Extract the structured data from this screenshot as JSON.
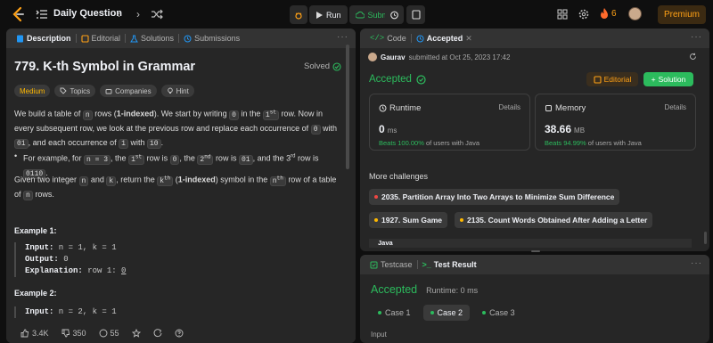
{
  "topbar": {
    "list_label": "Daily Question",
    "run_label": "Run",
    "submit_label": "Submit",
    "streak_count": "6",
    "premium_label": "Premium"
  },
  "left_tabs": [
    "Description",
    "Editorial",
    "Solutions",
    "Submissions"
  ],
  "problem": {
    "title": "779. K-th Symbol in Grammar",
    "status": "Solved",
    "chips": [
      "Medium",
      "Topics",
      "Companies",
      "Hint"
    ],
    "p1": {
      "t1": "We build a table of ",
      "c1": "n",
      "t2": " rows (",
      "b1": "1-indexed",
      "t3": "). We start by writing ",
      "c2": "0",
      "t4": " in the ",
      "s1": "1",
      "sup1": "st",
      "t5": " row. Now in every subsequent row, we look at the previous row and replace each occurrence of ",
      "c3": "0",
      "t6": " with ",
      "c4": "01",
      "t7": ", and each occurrence of ",
      "c5": "1",
      "t8": " with ",
      "c6": "10",
      "t9": "."
    },
    "bullet": {
      "t1": "For example, for ",
      "c1": "n = 3",
      "t2": ", the ",
      "s1": "1",
      "sup1": "st",
      "t3": " row is ",
      "c2": "0",
      "t4": ", the ",
      "s2": "2",
      "sup2": "nd",
      "t5": " row is ",
      "c3": "01",
      "t6": ", and the 3",
      "sup3": "rd",
      "t7": " row is ",
      "c4": "0110",
      "t8": "."
    },
    "p2": {
      "t1": "Given two integer ",
      "c1": "n",
      "t2": " and ",
      "c2": "k",
      "t3": ", return the ",
      "s1": "k",
      "sup1": "th",
      "t4": " (",
      "b1": "1-indexed",
      "t5": ") symbol in the ",
      "s2": "n",
      "sup2": "th",
      "t6": " row of a table of ",
      "c3": "n",
      "t7": " rows."
    },
    "example1": {
      "heading": "Example 1:",
      "input_label": "Input:",
      "input_val": " n = 1, k = 1",
      "output_label": "Output:",
      "output_val": " 0",
      "expl_label": "Explanation:",
      "expl_val": " row 1: ",
      "expl_u": "0"
    },
    "example2": {
      "heading": "Example 2:",
      "input_label": "Input:",
      "input_val": " n = 2, k = 1"
    },
    "footer": {
      "likes": "3.4K",
      "dislikes": "350",
      "comments": "55"
    }
  },
  "right_top": {
    "tabs": [
      "Code",
      "Accepted"
    ],
    "submitter": "Gaurav",
    "submitted_text": "submitted at Oct 25, 2023 17:42",
    "status": "Accepted",
    "editorial_label": "Editorial",
    "solution_label": "Solution",
    "runtime": {
      "label": "Runtime",
      "details": "Details",
      "value": "0",
      "unit": "ms",
      "beats_pct": "Beats 100.00%",
      "beats_rest": " of users with Java"
    },
    "memory": {
      "label": "Memory",
      "details": "Details",
      "value": "38.66",
      "unit": "MB",
      "beats_pct": "Beats 94.99%",
      "beats_rest": " of users with Java"
    },
    "more_heading": "More challenges",
    "challenges": [
      {
        "title": "2035. Partition Array Into Two Arrays to Minimize Sum Difference",
        "color": "#ef4743"
      },
      {
        "title": "1927. Sum Game",
        "color": "#ffb800"
      },
      {
        "title": "2135. Count Words Obtained After Adding a Letter",
        "color": "#ffb800"
      }
    ],
    "lang": "Java"
  },
  "right_bottom": {
    "tabs": [
      "Testcase",
      "Test Result"
    ],
    "status": "Accepted",
    "runtime": "Runtime: 0 ms",
    "cases": [
      "Case 1",
      "Case 2",
      "Case 3"
    ],
    "input_label": "Input"
  },
  "colors": {
    "accent_green": "#2cbb5d",
    "accent_orange": "#ffa116",
    "medium": "#ffb800",
    "hard": "#ef4743"
  }
}
